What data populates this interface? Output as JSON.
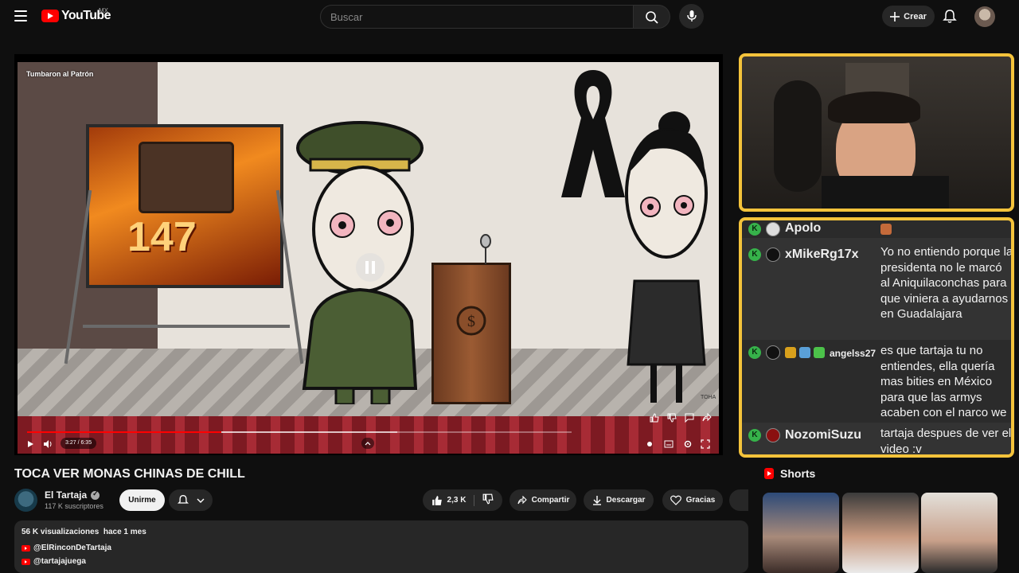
{
  "header": {
    "logo_text": "YouTube",
    "country_code": "MX",
    "search_placeholder": "Buscar",
    "create_label": "Crear"
  },
  "player": {
    "video_overlay_title": "Tumbaron al Patrón",
    "board_number": "147",
    "watermark": "TOHA",
    "time": "3:27 / 6:35",
    "progress_fraction": 0.524,
    "buffer_fraction": 1.0,
    "play_state": "paused"
  },
  "chat": {
    "messages": [
      {
        "user": "Apolo",
        "text": ""
      },
      {
        "user": "xMikeRg17x",
        "text": "Yo no entiendo porque la presidenta no le marcó al Aniquilaconchas para que viniera a ayudarnos en Guadalajara"
      },
      {
        "user": "angelss27",
        "text": "es que tartaja tu no entiendes, ella quería mas bities en México para que las armys acaben con el narco we"
      },
      {
        "user": "NozomiSuzu",
        "text": "tartaja despues de ver el video :v"
      }
    ],
    "badge_letter": "K"
  },
  "video": {
    "title": "TOCA VER MONAS CHINAS DE CHILL",
    "channel_name": "El Tartaja",
    "subscribers": "117 K suscriptores",
    "join_label": "Unirme",
    "likes": "2,3 K",
    "share_label": "Compartir",
    "download_label": "Descargar",
    "thanks_label": "Gracias"
  },
  "description": {
    "views": "56 K visualizaciones",
    "date": "hace 1 mes",
    "links": [
      "@ElRinconDeTartaja",
      "@tartajajuega"
    ]
  },
  "shorts": {
    "heading": "Shorts"
  },
  "colors": {
    "accent_red": "#ff0000",
    "overlay_border": "#f4c33b",
    "chat_badge": "#36b24a"
  }
}
